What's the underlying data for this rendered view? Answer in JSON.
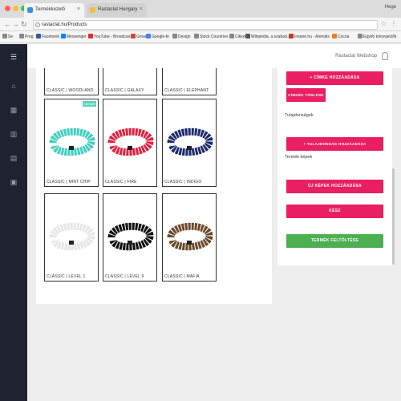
{
  "browser": {
    "tabs": [
      {
        "title": "Termékkezelő",
        "active": true
      },
      {
        "title": "Rastaclat Hungary",
        "active": false
      }
    ],
    "profile": "Hege",
    "url": "rastaclat.hu/Products",
    "bookmarks": [
      "Se",
      "Prog",
      "Facebook",
      "Messenger",
      "YouTube - Broadcas...",
      "Gmail",
      "Google-fe",
      "Design",
      "Stock Countries",
      "Cikkek",
      "Wikipédia, a szabad...",
      "Insane.hu - Animáls",
      "Cocoa",
      "Egyéb könyvjelzők"
    ]
  },
  "sidebar": {
    "icons": [
      "menu-icon",
      "bank-icon",
      "grid-icon",
      "chart-icon",
      "book-icon",
      "clipboard-icon"
    ]
  },
  "topbar": {
    "user": "Rastaclat Webshop"
  },
  "products": [
    {
      "label": "CLASSIC | WOODLAND",
      "color": "#5a4a2e",
      "partial": true
    },
    {
      "label": "CLASSIC | GALAXY",
      "color": "#3b2f5a",
      "partial": true
    },
    {
      "label": "CLASSIC | ELEPHANT",
      "color": "#888888",
      "partial": true
    },
    {
      "label": "CLASSIC | MINT CHIP",
      "color": "#3fcfbf",
      "badge": "kiemelt"
    },
    {
      "label": "CLASSIC | FIRE",
      "color": "#e0213f"
    },
    {
      "label": "CLASSIC | INDIGO",
      "color": "#1e2a6b"
    },
    {
      "label": "CLASSIC | LEVEL 1",
      "color": "#f2f2f2"
    },
    {
      "label": "CLASSIC | LEVEL 9",
      "color": "#111111"
    },
    {
      "label": "CLASSIC | MAFIA",
      "color": "#6b4a2a"
    }
  ],
  "right_panel": {
    "add_tag": "+ CÍMKE HOZZÁADÁSA",
    "delete_tags": "CÍMKÉK TÖRLÉSE",
    "properties_label": "Tulajdonságok",
    "add_property": "+ TULAJDONSÁG HOZZÁADÁSA",
    "images_label": "Termék képek",
    "add_images": "ÚJ KÉPEK HOZZÁADÁSA",
    "done": "KÉSZ",
    "upload": "TERMÉK FELTÖLTÉSE"
  },
  "colors": {
    "accent": "#e91e63",
    "success": "#4caf50",
    "sidebar": "#1f2230"
  }
}
